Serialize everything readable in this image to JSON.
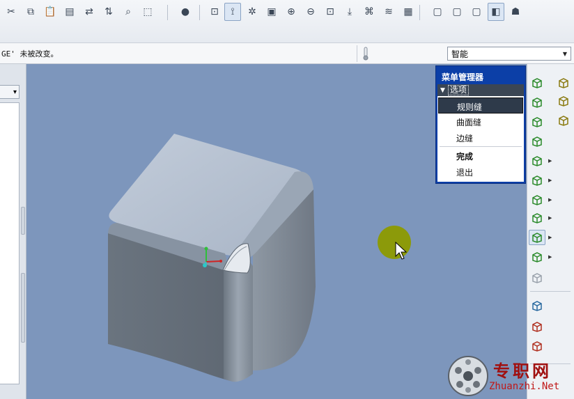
{
  "toolbar": {
    "buttons": [
      {
        "name": "cut-icon",
        "glyph": "✂"
      },
      {
        "name": "copy-icon",
        "glyph": "⧉"
      },
      {
        "name": "paste-icon",
        "glyph": "📋"
      },
      {
        "name": "paste-special-icon",
        "glyph": "▤"
      },
      {
        "name": "regenerate-icon",
        "glyph": "⇄"
      },
      {
        "name": "regen-manager-icon",
        "glyph": "⇅"
      },
      {
        "name": "find-icon",
        "glyph": "⌕"
      },
      {
        "name": "select-box-icon",
        "glyph": "⬚"
      },
      {
        "name": "appearance-sphere-icon",
        "glyph": "●"
      },
      {
        "name": "repaint-icon",
        "glyph": "⊡"
      },
      {
        "name": "spin-center-icon",
        "glyph": "⟟"
      },
      {
        "name": "orient-mode-icon",
        "glyph": "✲"
      },
      {
        "name": "view-manager-icon",
        "glyph": "▣"
      },
      {
        "name": "zoom-in-icon",
        "glyph": "⊕"
      },
      {
        "name": "zoom-out-icon",
        "glyph": "⊖"
      },
      {
        "name": "refit-icon",
        "glyph": "⊡"
      },
      {
        "name": "reorient-icon",
        "glyph": "⤓"
      },
      {
        "name": "saved-views-icon",
        "glyph": "⌘"
      },
      {
        "name": "layers-icon",
        "glyph": "≋"
      },
      {
        "name": "view-list-icon",
        "glyph": "▦"
      },
      {
        "name": "wireframe-icon",
        "glyph": "▢"
      },
      {
        "name": "hidden-line-icon",
        "glyph": "▢"
      },
      {
        "name": "no-hidden-icon",
        "glyph": "▢"
      },
      {
        "name": "shading-icon",
        "glyph": "◧"
      },
      {
        "name": "model-tree-icon",
        "glyph": "☗"
      }
    ]
  },
  "message": {
    "text": "GE' 未被改变。"
  },
  "filter": {
    "value": "智能"
  },
  "menu_manager": {
    "title": "菜单管理器",
    "section": "选项",
    "items": [
      {
        "label": "规则缝",
        "selected": true
      },
      {
        "label": "曲面缝",
        "selected": false
      },
      {
        "label": "边缝",
        "selected": false
      }
    ],
    "actions": [
      {
        "label": "完成"
      },
      {
        "label": "退出"
      }
    ]
  },
  "watermark": {
    "title": "专职网",
    "url": "Zhuanzhi.Net"
  },
  "colors": {
    "viewport_bg": "#7d96bc",
    "menu_title_bg": "#0c3fa7",
    "cube_top": "#b3bfd0",
    "cube_front": "#6f7985",
    "cube_right": "#7e8892",
    "cursor_highlight": "#8c9a0a"
  }
}
